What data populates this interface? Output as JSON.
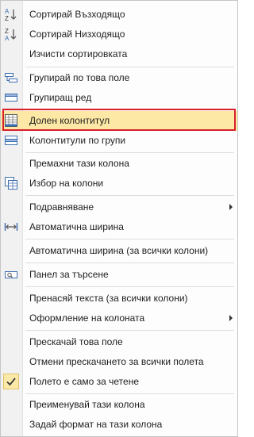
{
  "menu": {
    "items": [
      {
        "label": "Сортирай Възходящо",
        "icon": "sort-az-icon"
      },
      {
        "label": "Сортирай Низходящо",
        "icon": "sort-za-icon"
      },
      {
        "label": "Изчисти сортировката"
      },
      {
        "label": "Групирай по това поле",
        "icon": "group-by-field-icon"
      },
      {
        "label": "Групиращ ред",
        "icon": "group-row-icon"
      },
      {
        "label": "Долен колонтитул",
        "icon": "footer-icon",
        "highlighted": true
      },
      {
        "label": "Колонтитули по групи",
        "icon": "group-footers-icon"
      },
      {
        "label": "Премахни тази колона"
      },
      {
        "label": "Избор на колони",
        "icon": "column-chooser-icon"
      },
      {
        "label": "Подравняване",
        "submenu": true
      },
      {
        "label": "Автоматична ширина",
        "icon": "best-fit-icon"
      },
      {
        "label": "Автоматична ширина (за всички колони)"
      },
      {
        "label": "Панел за търсене",
        "icon": "find-panel-icon"
      },
      {
        "label": "Пренасяй текста (за всички колони)"
      },
      {
        "label": "Оформление на колоната",
        "submenu": true
      },
      {
        "label": "Прескачай това поле"
      },
      {
        "label": "Отмени прескачането за всички полета"
      },
      {
        "label": "Полето е само за четене",
        "icon": "checkmark-icon",
        "checked": true
      },
      {
        "label": "Преименувай тази колона"
      },
      {
        "label": "Задай формат на тази колона"
      }
    ]
  },
  "colors": {
    "highlight_border": "#d8202a",
    "highlight_bg": "#fde8a6",
    "icon_blue": "#3f6fb0"
  }
}
